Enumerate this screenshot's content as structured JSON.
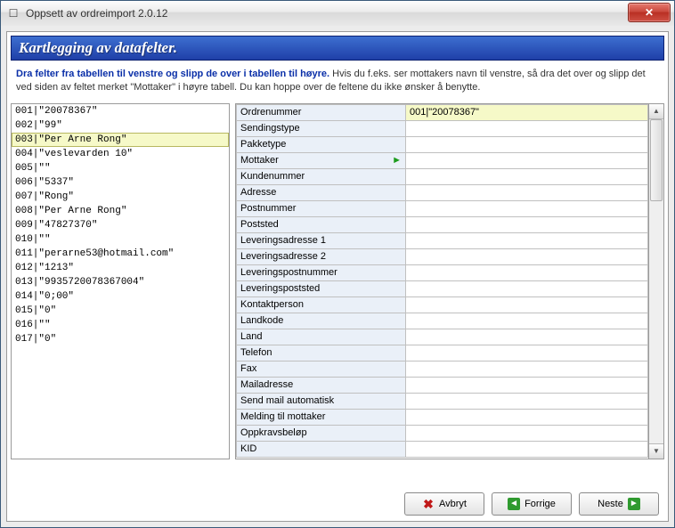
{
  "window": {
    "title": "Oppsett av ordreimport 2.0.12"
  },
  "header": {
    "title": "Kartlegging av datafelter."
  },
  "instructions": {
    "bold": "Dra felter fra tabellen til venstre og slipp de over i tabellen til høyre.",
    "rest": " Hvis du f.eks. ser mottakers navn til venstre, så dra det over og slipp det ved siden av feltet merket \"Mottaker\" i høyre tabell. Du kan hoppe over de feltene du ikke ønsker å benytte."
  },
  "left_rows": [
    "001|\"20078367\"",
    "002|\"99\"",
    "003|\"Per Arne Rong\"",
    "004|\"veslevarden 10\"",
    "005|\"\"",
    "006|\"5337\"",
    "007|\"Rong\"",
    "008|\"Per Arne Rong\"",
    "009|\"47827370\"",
    "010|\"\"",
    "011|\"perarne53@hotmail.com\"",
    "012|\"1213\"",
    "013|\"9935720078367004\"",
    "014|\"0;00\"",
    "015|\"0\"",
    "016|\"\"",
    "017|\"0\""
  ],
  "left_selected_index": 2,
  "grid_rows": [
    {
      "label": "Ordrenummer",
      "value": "001|\"20078367\"",
      "highlight": true
    },
    {
      "label": "Sendingstype",
      "value": ""
    },
    {
      "label": "Pakketype",
      "value": ""
    },
    {
      "label": "Mottaker",
      "value": "",
      "marker": "►"
    },
    {
      "label": "Kundenummer",
      "value": ""
    },
    {
      "label": "Adresse",
      "value": ""
    },
    {
      "label": "Postnummer",
      "value": ""
    },
    {
      "label": "Poststed",
      "value": ""
    },
    {
      "label": "Leveringsadresse 1",
      "value": ""
    },
    {
      "label": "Leveringsadresse 2",
      "value": ""
    },
    {
      "label": "Leveringspostnummer",
      "value": ""
    },
    {
      "label": "Leveringspoststed",
      "value": ""
    },
    {
      "label": "Kontaktperson",
      "value": ""
    },
    {
      "label": "Landkode",
      "value": ""
    },
    {
      "label": "Land",
      "value": ""
    },
    {
      "label": "Telefon",
      "value": ""
    },
    {
      "label": "Fax",
      "value": ""
    },
    {
      "label": "Mailadresse",
      "value": ""
    },
    {
      "label": "Send mail automatisk",
      "value": ""
    },
    {
      "label": "Melding til mottaker",
      "value": ""
    },
    {
      "label": "Oppkravsbeløp",
      "value": ""
    },
    {
      "label": "KID",
      "value": ""
    }
  ],
  "buttons": {
    "cancel": "Avbryt",
    "prev": "Forrige",
    "next": "Neste"
  }
}
